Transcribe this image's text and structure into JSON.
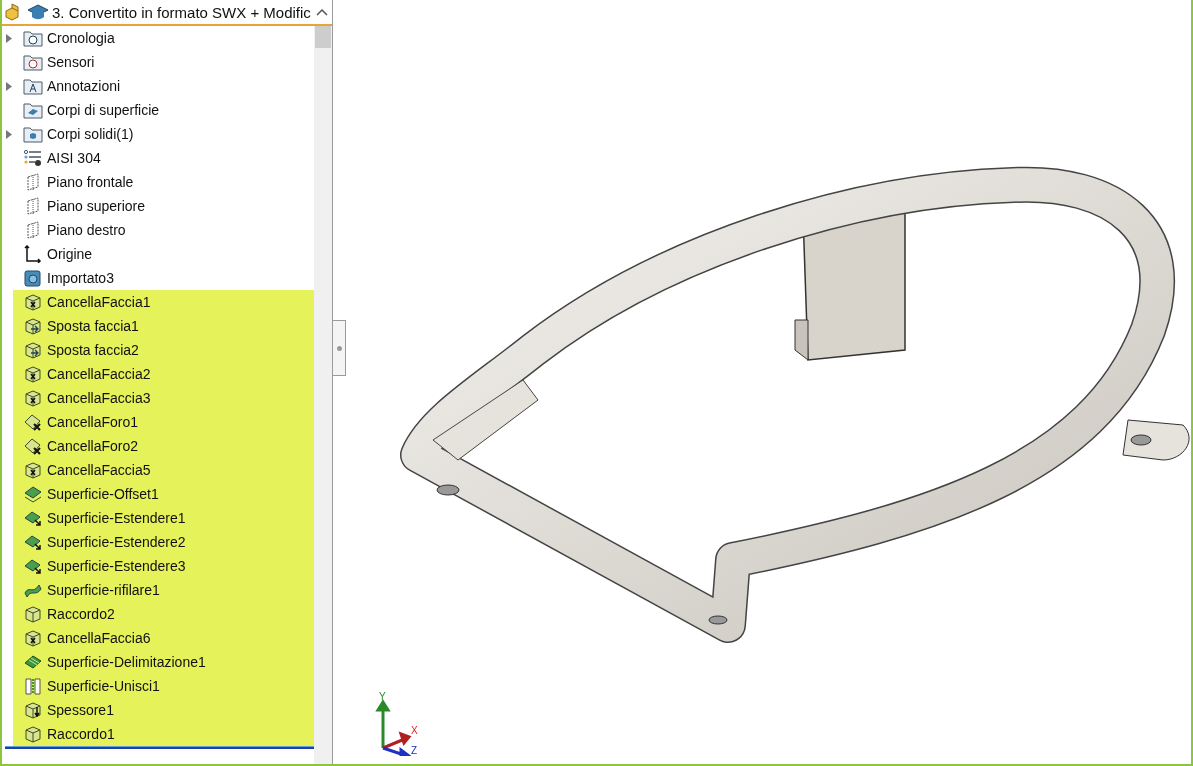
{
  "tree": {
    "title": "3. Convertito in formato SWX + Modific",
    "items": [
      {
        "label": "Cronologia",
        "kind": "history-folder",
        "expanded": false,
        "highlighted": false
      },
      {
        "label": "Sensori",
        "kind": "sensor-folder",
        "highlighted": false
      },
      {
        "label": "Annotazioni",
        "kind": "annotation-folder",
        "expanded": false,
        "highlighted": false
      },
      {
        "label": "Corpi di superficie",
        "kind": "surface-folder",
        "highlighted": false
      },
      {
        "label": "Corpi solidi(1)",
        "kind": "solid-folder",
        "expanded": false,
        "highlighted": false
      },
      {
        "label": "AISI 304",
        "kind": "material",
        "highlighted": false
      },
      {
        "label": "Piano frontale",
        "kind": "plane",
        "highlighted": false
      },
      {
        "label": "Piano superiore",
        "kind": "plane",
        "highlighted": false
      },
      {
        "label": "Piano destro",
        "kind": "plane",
        "highlighted": false
      },
      {
        "label": "Origine",
        "kind": "origin",
        "highlighted": false
      },
      {
        "label": "Importato3",
        "kind": "imported",
        "highlighted": false
      },
      {
        "label": "CancellaFaccia1",
        "kind": "delete-face",
        "highlighted": true
      },
      {
        "label": "Sposta faccia1",
        "kind": "move-face",
        "highlighted": true
      },
      {
        "label": "Sposta faccia2",
        "kind": "move-face",
        "highlighted": true
      },
      {
        "label": "CancellaFaccia2",
        "kind": "delete-face",
        "highlighted": true
      },
      {
        "label": "CancellaFaccia3",
        "kind": "delete-face",
        "highlighted": true
      },
      {
        "label": "CancellaForo1",
        "kind": "delete-hole",
        "highlighted": true
      },
      {
        "label": "CancellaForo2",
        "kind": "delete-hole",
        "highlighted": true
      },
      {
        "label": "CancellaFaccia5",
        "kind": "delete-face",
        "highlighted": true
      },
      {
        "label": "Superficie-Offset1",
        "kind": "offset-surface",
        "highlighted": true
      },
      {
        "label": "Superficie-Estendere1",
        "kind": "extend-surface",
        "highlighted": true
      },
      {
        "label": "Superficie-Estendere2",
        "kind": "extend-surface",
        "highlighted": true
      },
      {
        "label": "Superficie-Estendere3",
        "kind": "extend-surface",
        "highlighted": true
      },
      {
        "label": "Superficie-rifilare1",
        "kind": "trim-surface",
        "highlighted": true
      },
      {
        "label": "Raccordo2",
        "kind": "fillet",
        "highlighted": true
      },
      {
        "label": "CancellaFaccia6",
        "kind": "delete-face",
        "highlighted": true
      },
      {
        "label": "Superficie-Delimitazione1",
        "kind": "boundary-surface",
        "highlighted": true
      },
      {
        "label": "Superficie-Unisci1",
        "kind": "knit-surface",
        "highlighted": true
      },
      {
        "label": "Spessore1",
        "kind": "thicken",
        "highlighted": true
      },
      {
        "label": "Raccordo1",
        "kind": "fillet",
        "highlighted": true
      }
    ]
  },
  "viewport": {
    "triad": {
      "x": "X",
      "y": "Y",
      "z": "Z"
    }
  }
}
